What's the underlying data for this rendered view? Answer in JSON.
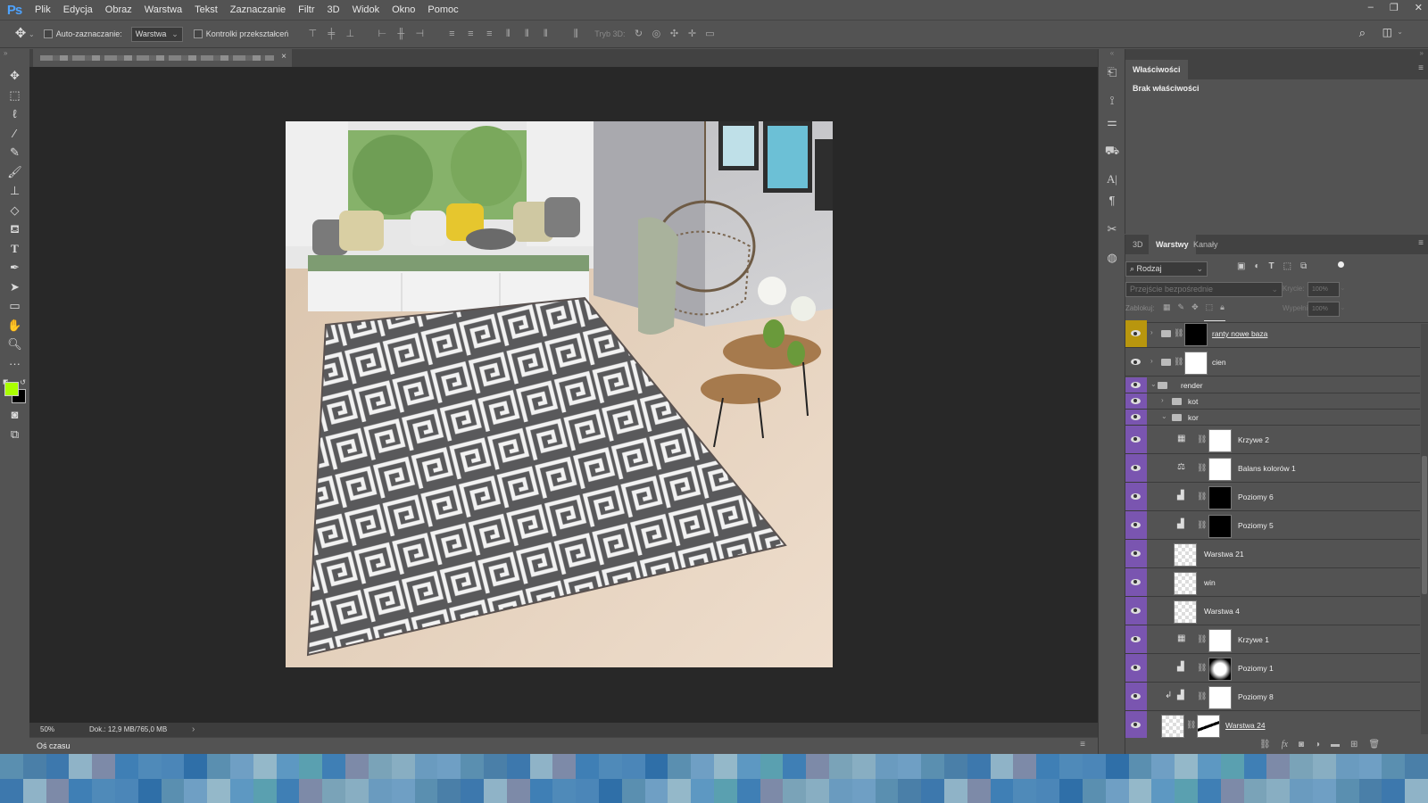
{
  "app": {
    "logo": "Ps"
  },
  "menu": [
    "Plik",
    "Edycja",
    "Obraz",
    "Warstwa",
    "Tekst",
    "Zaznaczanie",
    "Filtr",
    "3D",
    "Widok",
    "Okno",
    "Pomoc"
  ],
  "options": {
    "auto_select_label": "Auto-zaznaczanie:",
    "auto_select_value": "Warstwa",
    "transform_label": "Kontrolki przekształceń",
    "mode3d_label": "Tryb 3D:"
  },
  "document": {
    "tab_close": "×",
    "zoom": "50%",
    "doc_info": "Dok.: 12,9 MB/765,0 MB"
  },
  "timeline": {
    "label": "Oś czasu"
  },
  "properties": {
    "tab": "Właściwości",
    "empty": "Brak właściwości"
  },
  "layers_panel": {
    "tabs": [
      "3D",
      "Warstwy",
      "Kanały"
    ],
    "filter_value": "Rodzaj",
    "blend_mode": "Przejście bezpośrednie",
    "opacity_label": "Krycie:",
    "opacity_value": "100%",
    "lock_label": "Zablokuj:",
    "fill_label": "Wypełnienie:",
    "fill_value": "100%",
    "layers": [
      {
        "name": "ranty nowe baza",
        "kind": "group-mask",
        "color": "#b8960e",
        "underline": true
      },
      {
        "name": "cien",
        "kind": "group-white",
        "color": "#535353"
      },
      {
        "name": "render",
        "kind": "group-open",
        "color": "#7a55b0"
      },
      {
        "name": "kot",
        "kind": "subgroup",
        "color": "#7a55b0"
      },
      {
        "name": "kor",
        "kind": "subgroup-open",
        "color": "#7a55b0"
      },
      {
        "name": "Krzywe 2",
        "kind": "curves",
        "color": "#7a55b0"
      },
      {
        "name": "Balans kolorów 1",
        "kind": "balance",
        "color": "#7a55b0"
      },
      {
        "name": "Poziomy 6",
        "kind": "levels-black",
        "color": "#7a55b0"
      },
      {
        "name": "Poziomy 5",
        "kind": "levels-black",
        "color": "#7a55b0"
      },
      {
        "name": "Warstwa 21",
        "kind": "pixel",
        "color": "#7a55b0"
      },
      {
        "name": "win",
        "kind": "pixel",
        "color": "#7a55b0"
      },
      {
        "name": "Warstwa 4",
        "kind": "pixel",
        "color": "#7a55b0"
      },
      {
        "name": "Krzywe 1",
        "kind": "curves",
        "color": "#7a55b0"
      },
      {
        "name": "Poziomy 1",
        "kind": "levels-blur",
        "color": "#7a55b0"
      },
      {
        "name": "Poziomy 8",
        "kind": "levels-clip",
        "color": "#7a55b0"
      },
      {
        "name": "Warstwa 24",
        "kind": "pixel-mask",
        "color": "#7a55b0",
        "underline": true
      }
    ]
  }
}
